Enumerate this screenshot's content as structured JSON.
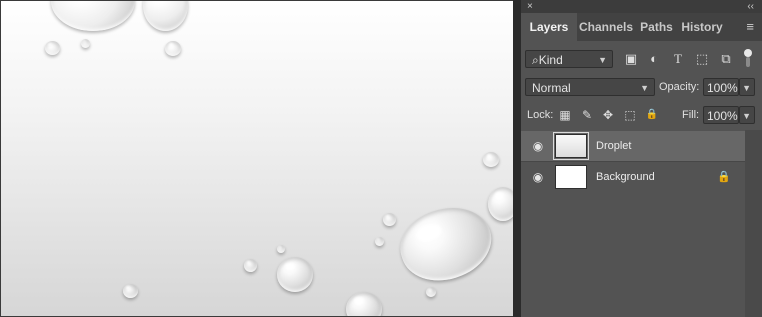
{
  "panel": {
    "close_symbol": "×",
    "collapse_symbol": "‹‹",
    "menu_symbol": "≡",
    "tabs": [
      {
        "label": "Layers",
        "active": true
      },
      {
        "label": "Channels",
        "active": false
      },
      {
        "label": "Paths",
        "active": false
      },
      {
        "label": "History",
        "active": false
      }
    ],
    "filter": {
      "kind_label": "Kind",
      "search_symbol": "⌕",
      "icons": [
        "image-filter-icon",
        "adjustment-filter-icon",
        "type-filter-icon",
        "shape-filter-icon",
        "smart-object-filter-icon"
      ],
      "icon_glyphs": [
        "▣",
        "◐",
        "T",
        "⬚",
        "⧉"
      ]
    },
    "blend_mode": "Normal",
    "opacity": {
      "label": "Opacity:",
      "value": "100%"
    },
    "lock": {
      "label": "Lock:",
      "icons": [
        "lock-transparency-icon",
        "lock-pixels-icon",
        "lock-position-icon",
        "lock-artboard-icon",
        "lock-all-icon"
      ],
      "icon_glyphs": [
        "▦",
        "✎",
        "✥",
        "⬚",
        "🔒"
      ]
    },
    "fill": {
      "label": "Fill:",
      "value": "100%"
    },
    "layers": [
      {
        "name": "Droplet",
        "selected": true,
        "visible": true,
        "locked": false
      },
      {
        "name": "Background",
        "selected": false,
        "visible": true,
        "locked": true
      }
    ],
    "eye_glyph": "◉",
    "lock_glyph": "🔒"
  },
  "colors": {
    "panel_bg": "#535353",
    "tab_bar_bg": "#424242",
    "selected_layer_bg": "#676767"
  }
}
